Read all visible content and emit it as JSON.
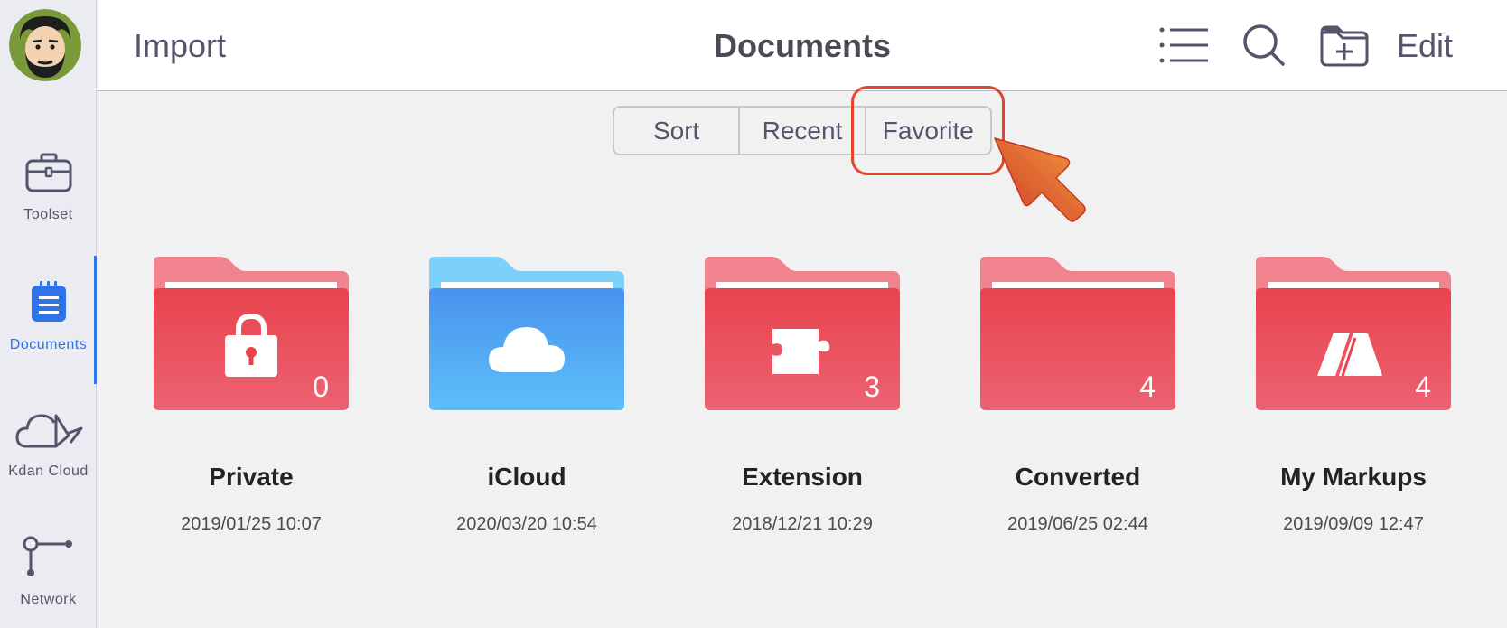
{
  "sidebar": {
    "items": [
      {
        "label": "Toolset",
        "icon": "briefcase-icon"
      },
      {
        "label": "Documents",
        "icon": "document-icon"
      },
      {
        "label": "Kdan Cloud",
        "icon": "kdan-cloud-icon"
      },
      {
        "label": "Network",
        "icon": "network-icon"
      }
    ],
    "active_index": 1,
    "accent": "#2f73e8"
  },
  "header": {
    "import_label": "Import",
    "title": "Documents",
    "edit_label": "Edit"
  },
  "segments": [
    {
      "label": "Sort"
    },
    {
      "label": "Recent"
    },
    {
      "label": "Favorite"
    }
  ],
  "folders": [
    {
      "name": "Private",
      "date": "2019/01/25 10:07",
      "count": "0",
      "color": "red",
      "icon": "lock-icon"
    },
    {
      "name": "iCloud",
      "date": "2020/03/20 10:54",
      "count": "",
      "color": "blue",
      "icon": "cloud-icon"
    },
    {
      "name": "Extension",
      "date": "2018/12/21 10:29",
      "count": "3",
      "color": "red",
      "icon": "puzzle-icon"
    },
    {
      "name": "Converted",
      "date": "2019/06/25 02:44",
      "count": "4",
      "color": "red",
      "icon": ""
    },
    {
      "name": "My Markups",
      "date": "2019/09/09 12:47",
      "count": "4",
      "color": "red",
      "icon": "markup-icon"
    }
  ],
  "colors": {
    "folder_red": "#e84a54",
    "folder_blue": "#4a9ef0",
    "highlight": "#e0452e"
  }
}
